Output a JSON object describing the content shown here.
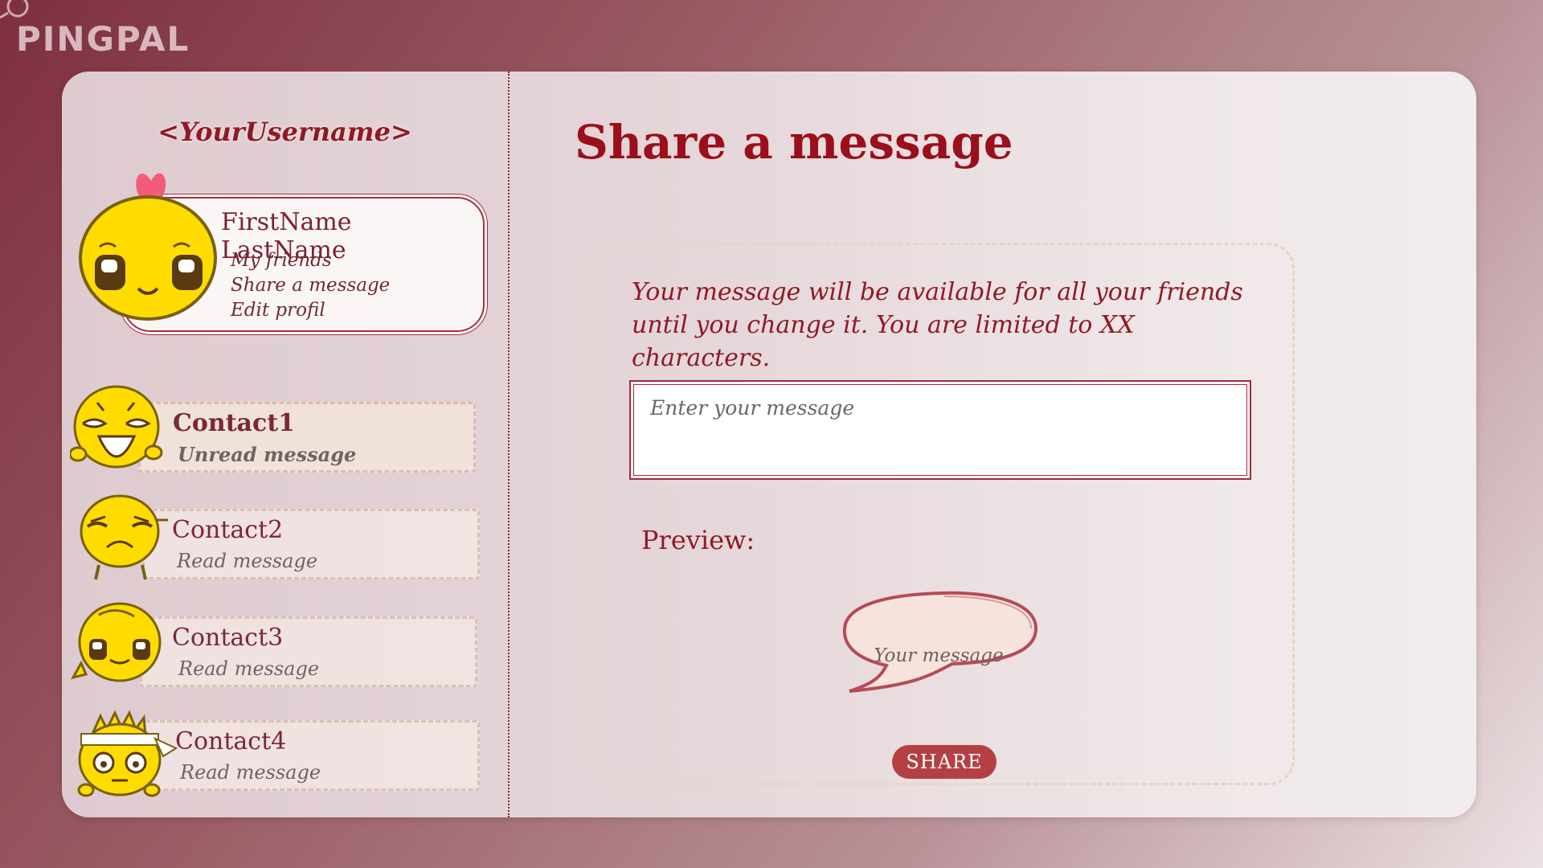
{
  "app": {
    "logo_text": "PINGPAL"
  },
  "sidebar": {
    "username": "<YourUsername>",
    "profile": {
      "full_name": "FirstName LastName",
      "menu": [
        "My friends",
        "Share a message",
        "Edit profil"
      ]
    },
    "contacts": [
      {
        "name": "Contact1",
        "status": "Unread message",
        "unread": true
      },
      {
        "name": "Contact2",
        "status": "Read message",
        "unread": false
      },
      {
        "name": "Contact3",
        "status": "Read message",
        "unread": false
      },
      {
        "name": "Contact4",
        "status": "Read message",
        "unread": false
      }
    ]
  },
  "main": {
    "title": "Share a message",
    "info_line1": "Your message will be available for all your friends",
    "info_line2": "until you change it. You are limited to XX characters.",
    "message_input": {
      "placeholder": "Enter your message",
      "value": ""
    },
    "preview_label": "Preview:",
    "preview_bubble_text": "Your message",
    "share_button": "SHARE"
  },
  "colors": {
    "accent": "#9b0f1a",
    "share_button": "#b54043",
    "avatar_yellow": "#ffdc00"
  }
}
